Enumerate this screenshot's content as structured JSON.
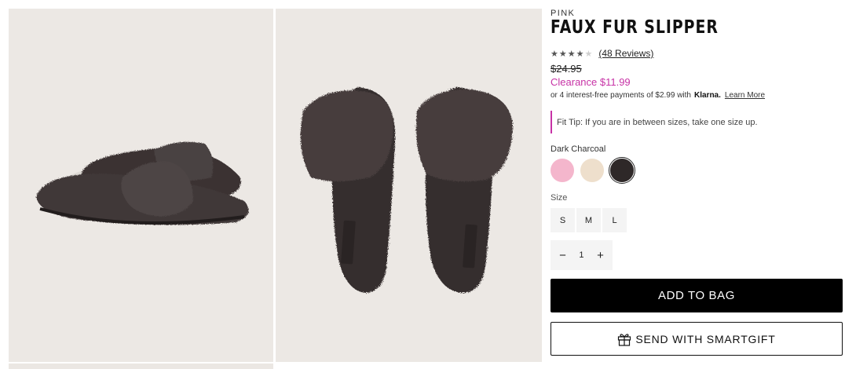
{
  "images": [
    {
      "alt_icon": "slipper-side-view-image"
    },
    {
      "alt_icon": "slipper-top-view-image"
    }
  ],
  "product": {
    "brand": "PINK",
    "title": "FAUX FUR SLIPPER",
    "rating": 4,
    "rating_max": 5,
    "reviews_label": "(48 Reviews)",
    "original_price": "$24.95",
    "sale_price": "Clearance $11.99",
    "installments_text": "or 4 interest-free payments of $2.99 with",
    "klarna_logo": "Klarna.",
    "learn_more": "Learn More",
    "fit_tip": "Fit Tip: If you are in between sizes, take one size up.",
    "selected_color": "Dark Charcoal",
    "colors": [
      {
        "name": "pink",
        "hex": "#f4b6cc"
      },
      {
        "name": "cream",
        "hex": "#eedfcc"
      },
      {
        "name": "dark-charcoal",
        "hex": "#2e2828",
        "selected": true
      }
    ],
    "size_label": "Size",
    "sizes": [
      "S",
      "M",
      "L"
    ],
    "quantity": "1",
    "qty_minus": "−",
    "qty_plus": "+",
    "add_to_bag": "ADD TO BAG",
    "smartgift": "SEND WITH SMARTGIFT"
  },
  "colors": {
    "accent": "#c733a6",
    "image_bg": "#ece8e4",
    "primary_button": "#000000"
  }
}
